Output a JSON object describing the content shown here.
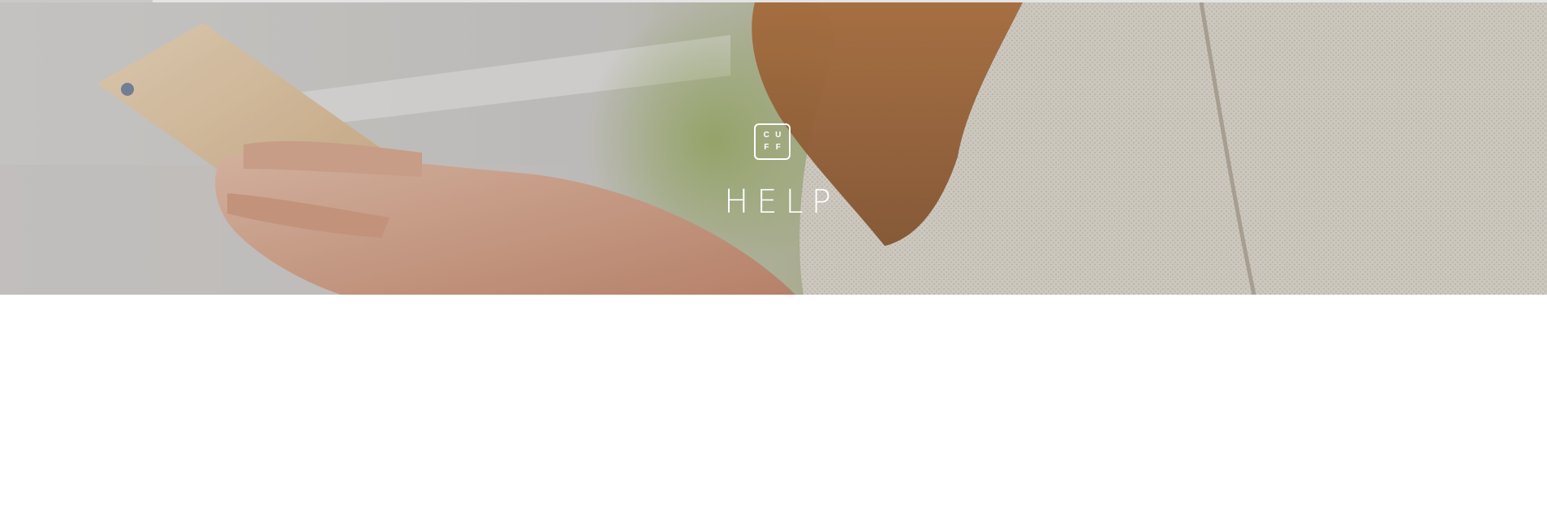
{
  "logo": {
    "letters": [
      "C",
      "U",
      "F",
      "F"
    ]
  },
  "hero": {
    "title": "HELP",
    "image": "woman-holding-phone-photo"
  }
}
